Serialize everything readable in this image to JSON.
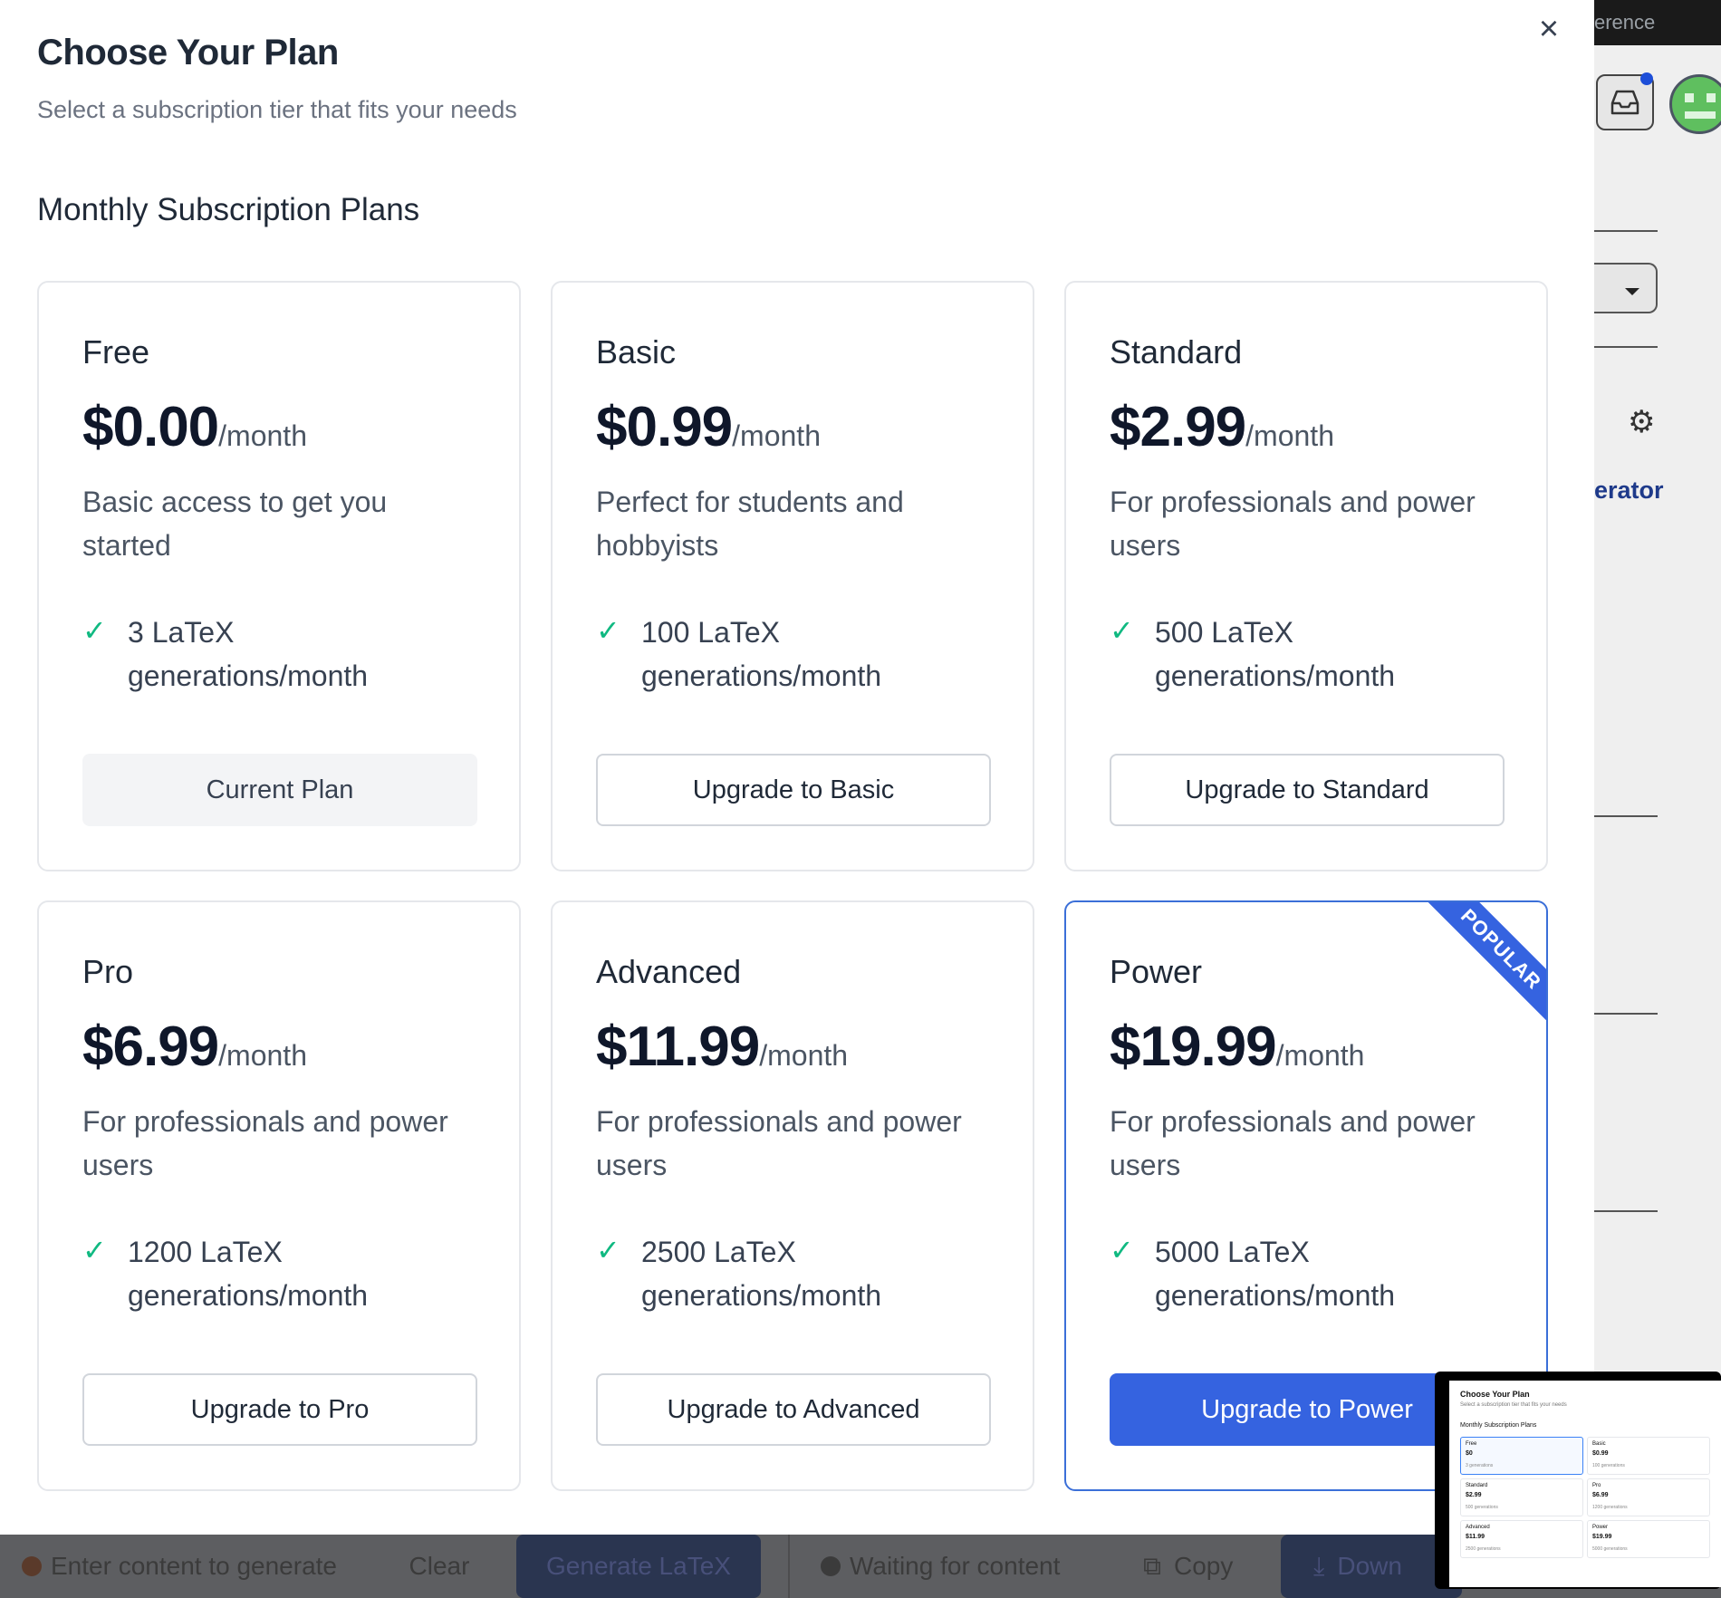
{
  "modal": {
    "title": "Choose Your Plan",
    "subtitle": "Select a subscription tier that fits your needs",
    "section_title": "Monthly Subscription Plans",
    "close_label": "×"
  },
  "plans": [
    {
      "name": "Free",
      "price": "$0.00",
      "period": "/month",
      "description": "Basic access to get you started",
      "feature": "3 LaTeX generations/month",
      "button": "Current Plan"
    },
    {
      "name": "Basic",
      "price": "$0.99",
      "period": "/month",
      "description": "Perfect for students and hobbyists",
      "feature": "100 LaTeX generations/month",
      "button": "Upgrade to Basic"
    },
    {
      "name": "Standard",
      "price": "$2.99",
      "period": "/month",
      "description": "For professionals and power users",
      "feature": "500 LaTeX generations/month",
      "button": "Upgrade to Standard"
    },
    {
      "name": "Pro",
      "price": "$6.99",
      "period": "/month",
      "description": "For professionals and power users",
      "feature": "1200 LaTeX generations/month",
      "button": "Upgrade to Pro"
    },
    {
      "name": "Advanced",
      "price": "$11.99",
      "period": "/month",
      "description": "For professionals and power users",
      "feature": "2500 LaTeX generations/month",
      "button": "Upgrade to Advanced"
    },
    {
      "name": "Power",
      "price": "$19.99",
      "period": "/month",
      "description": "For professionals and power users",
      "feature": "5000 LaTeX generations/month",
      "button": "Upgrade to Power",
      "badge": "POPULAR"
    }
  ],
  "check_icon": "✓",
  "background": {
    "topbar_text": "erence",
    "link_text": "erator",
    "status_input": "Enter content to generate",
    "clear_button": "Clear",
    "generate_button": "Generate LaTeX",
    "status_output": "Waiting for content",
    "copy_button": "Copy",
    "download_button": "Down"
  },
  "thumbnail": {
    "title": "Choose Your Plan",
    "subtitle": "Select a subscription tier that fits your needs",
    "section": "Monthly Subscription Plans",
    "cards": [
      {
        "name": "Free",
        "price": "$0",
        "gens": "3 generations"
      },
      {
        "name": "Basic",
        "price": "$0.99",
        "gens": "100 generations"
      },
      {
        "name": "Standard",
        "price": "$2.99",
        "gens": "500 generations"
      },
      {
        "name": "Pro",
        "price": "$6.99",
        "gens": "1200 generations"
      },
      {
        "name": "Advanced",
        "price": "$11.99",
        "gens": "2500 generations"
      },
      {
        "name": "Power",
        "price": "$19.99",
        "gens": "5000 generations"
      }
    ]
  },
  "colors": {
    "accent": "#3563e0",
    "check": "#10b981",
    "popular_border": "#3b6fd8"
  }
}
